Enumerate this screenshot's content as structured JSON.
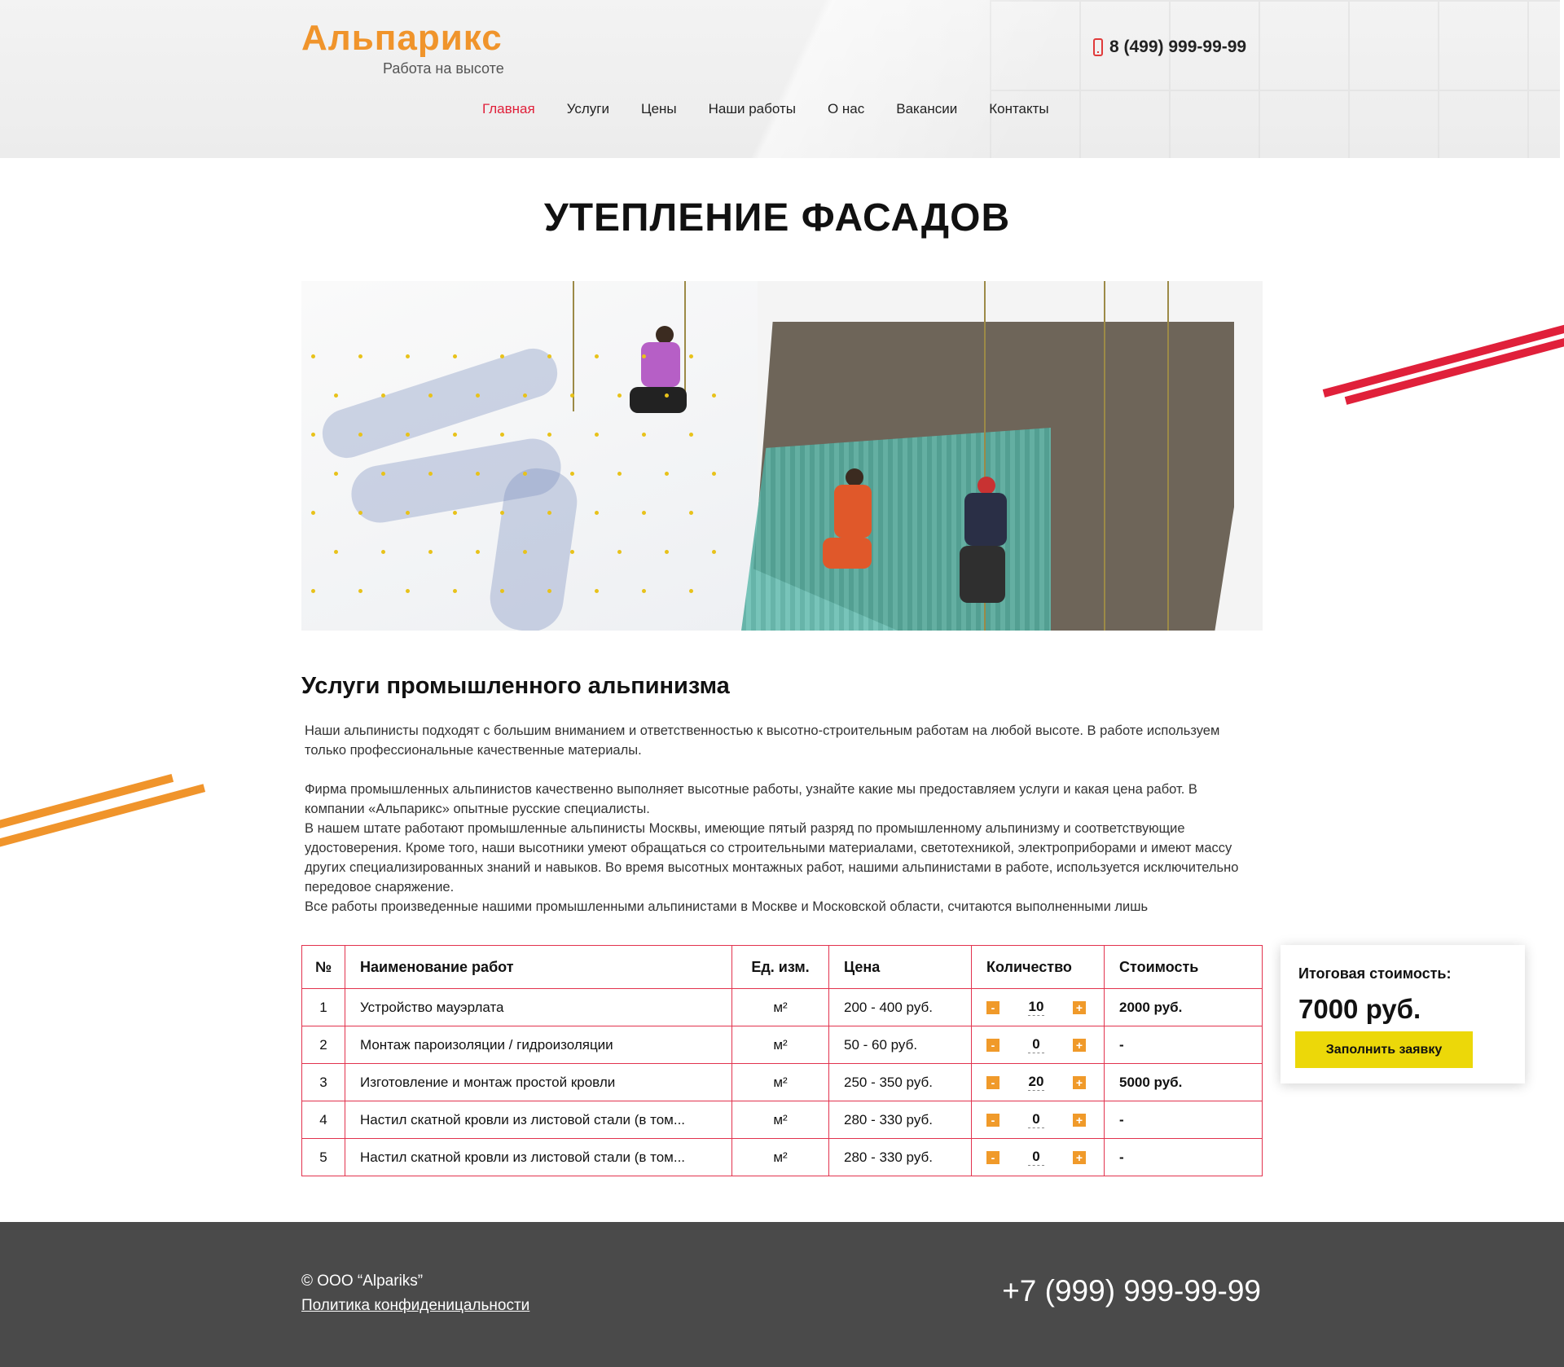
{
  "header": {
    "logo_name": "Альпарикс",
    "logo_sub": "Работа на высоте",
    "phone": "8 (499) 999-99-99",
    "nav": [
      {
        "label": "Главная",
        "active": true
      },
      {
        "label": "Услуги",
        "active": false
      },
      {
        "label": "Цены",
        "active": false
      },
      {
        "label": "Наши работы",
        "active": false
      },
      {
        "label": "О нас",
        "active": false
      },
      {
        "label": "Вакансии",
        "active": false
      },
      {
        "label": "Контакты",
        "active": false
      }
    ]
  },
  "page_title": "УТЕПЛЕНИЕ ФАСАДОВ",
  "section": {
    "heading": "Услуги промышленного альпинизма",
    "paragraphs": [
      "Наши альпинисты подходят с большим вниманием и ответственностью к высотно-строительным работам на любой высоте. В работе используем только профессиональные качественные  материалы.",
      "Фирма промышленных альпинистов качественно выполняет высотные работы, узнайте какие мы предоставляем услуги и какая цена работ. В компании «Альпарикс» опытные русские специалисты.",
      "В нашем штате работают промышленные альпинисты Москвы, имеющие пятый разряд по промышленному альпинизму и соответствующие удостоверения. Кроме того, наши высотники умеют обращаться со строительными материалами, светотехникой, электроприборами и имеют массу других специализированных знаний и навыков. Во время высотных монтажных работ, нашими альпинистами в работе, используется исключительно передовое снаряжение.",
      "Все работы произведенные нашими промышленными альпинистами в Москве и Московской области, считаются выполненными лишь"
    ]
  },
  "table": {
    "headers": {
      "num": "№",
      "name": "Наименование работ",
      "unit": "Ед. изм.",
      "price": "Цена",
      "qty": "Количество",
      "cost": "Стоимость"
    },
    "minus": "-",
    "plus": "+",
    "rows": [
      {
        "num": "1",
        "name": "Устройство мауэрлата",
        "unit": "м²",
        "price": "200 - 400 руб.",
        "qty": "10",
        "cost": "2000 руб."
      },
      {
        "num": "2",
        "name": "Монтаж пароизоляции / гидроизоляции",
        "unit": "м²",
        "price": "50 - 60 руб.",
        "qty": "0",
        "cost": "-"
      },
      {
        "num": "3",
        "name": "Изготовление и монтаж простой кровли",
        "unit": "м²",
        "price": "250 - 350 руб.",
        "qty": "20",
        "cost": "5000 руб."
      },
      {
        "num": "4",
        "name": "Настил скатной кровли из листовой стали  (в том...",
        "unit": "м²",
        "price": "280 - 330 руб.",
        "qty": "0",
        "cost": "-"
      },
      {
        "num": "5",
        "name": "Настил скатной кровли из листовой стали  (в том...",
        "unit": "м²",
        "price": "280 - 330 руб.",
        "qty": "0",
        "cost": "-"
      }
    ]
  },
  "total": {
    "label": "Итоговая стоимость:",
    "value": "7000 руб.",
    "button": "Заполнить заявку"
  },
  "footer": {
    "copyright": "© ООО “Alpariks”",
    "privacy": "Политика конфиденицальности",
    "phone": "+7 (999) 999-99-99"
  },
  "colors": {
    "accent_orange": "#f0942b",
    "accent_red": "#e0203a",
    "button_yellow": "#ecd809",
    "footer_bg": "#4a4a4a"
  }
}
